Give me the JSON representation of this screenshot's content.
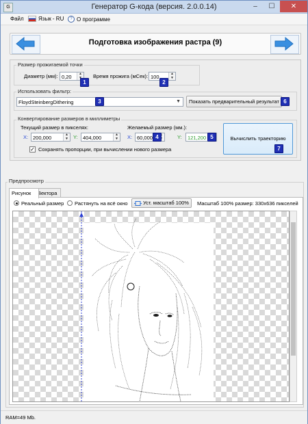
{
  "window": {
    "title": "Генератор G-кода (версия. 2.0.0.14)",
    "controls": {
      "minimize": "‒",
      "maximize": "☐",
      "close": "✕"
    }
  },
  "menu": {
    "file": "Файл",
    "language": "Язык - RU",
    "about": "О программе"
  },
  "header": {
    "title": "Подготовка изображения растра (9)",
    "back_icon": "arrow-left-icon",
    "forward_icon": "arrow-right-icon"
  },
  "burn": {
    "group_title": "Размер прожигаемой точки",
    "diameter_label": "Диаметр (мм):",
    "diameter_value": "0,20",
    "diameter_badge": "1",
    "time_label": "Время прожига (мСек):",
    "time_value": "100",
    "time_badge": "2"
  },
  "filter": {
    "group_title": "Использовать фильтр:",
    "selected": "FloydSteinbergDithering",
    "badge": "3",
    "preview_button": "Показать предварительный результат",
    "preview_badge": "6"
  },
  "convert": {
    "group_title": "Конвертирование размеров в миллиметры",
    "current_label": "Текущий размер в пикселях:",
    "current_x_label": "X:",
    "current_x": "200,000",
    "current_y_label": "Y:",
    "current_y": "404,000",
    "desired_label": "Желаемый размер (мм.):",
    "desired_x_label": "X:",
    "desired_x": "60,000",
    "desired_x_badge": "4",
    "desired_y_label": "Y:",
    "desired_y": "121,200",
    "desired_y_badge": "5",
    "keep_ratio": "Сохранять пропорции, при вычислении нового размера",
    "keep_ratio_checked": true,
    "compute_button": "Вычислить траекторию",
    "compute_badge": "7"
  },
  "preview": {
    "group_title": "Предпросмотр",
    "tabs": [
      "Рисунок",
      "Вектора"
    ],
    "radio_real": "Реальный размер",
    "radio_stretch": "Растянуть на всё окно",
    "zoom_button": "Уст. масштаб 100%",
    "scale_info": "Масштаб 100% размер: 330х636 пикселей"
  },
  "status": {
    "ram": "RAM=49 Mb."
  },
  "colors": {
    "badge": "#1f2fb4",
    "close": "#c75050",
    "arrow": "#3a8fe0",
    "ruler": "#2b3fd4"
  }
}
